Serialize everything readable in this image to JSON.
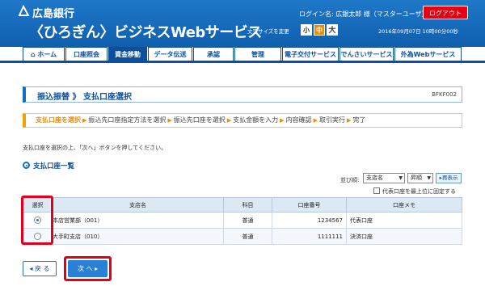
{
  "header": {
    "bank_name": "広島銀行",
    "service_name": "〈ひろぎん〉ビジネスWebサービス",
    "login_info": "ログイン名: 広銀太郎 様（マスターユーザ）",
    "logout_label": "ログアウト",
    "font_size_label": "文字サイズを変更",
    "font_sizes": [
      "小",
      "中",
      "大"
    ],
    "datetime": "2016年09月07日 10時00分00秒",
    "brand_color": "#1166b8",
    "logout_color": "#e60012"
  },
  "nav": {
    "tabs": [
      {
        "label": "ホーム",
        "icon": "home-icon"
      },
      {
        "label": "口座照会"
      },
      {
        "label": "資金移動"
      },
      {
        "label": "データ伝送"
      },
      {
        "label": "承認"
      },
      {
        "label": "管理"
      },
      {
        "label": "電子交付サービス"
      },
      {
        "label": "でんさいサービス"
      },
      {
        "label": "外為Webサービス"
      }
    ],
    "active_tab": "資金移動"
  },
  "page": {
    "title": "振込振替 》 支払口座選択",
    "screen_id": "BFKF002",
    "steps": [
      "支払口座を選択",
      "振込先口座指定方法を選択",
      "振込先口座を選択",
      "支払金額を入力",
      "内容確認",
      "取引実行",
      "完了"
    ],
    "current_step": "支払口座を選択",
    "instruction": "支払口座を選択の上、「次へ」ボタンを押してください。",
    "section_title": "支払口座一覧"
  },
  "sort": {
    "label": "並び順:",
    "field_value": "支店名",
    "order_value": "昇順",
    "resort_label": "再表示",
    "fix_label": "代表口座を最上位に固定する"
  },
  "table": {
    "headers": [
      "選択",
      "支店名",
      "科目",
      "口座番号",
      "口座メモ"
    ],
    "rows": [
      {
        "branch": "本店営業部（001）",
        "type": "普通",
        "number": "1234567",
        "memo": "代表口座",
        "selected": true
      },
      {
        "branch": "大手町支店（010）",
        "type": "普通",
        "number": "1111111",
        "memo": "決済口座",
        "selected": false
      }
    ]
  },
  "buttons": {
    "back": "戻 る",
    "next": "次 へ"
  },
  "highlight_color": "#e0001b"
}
